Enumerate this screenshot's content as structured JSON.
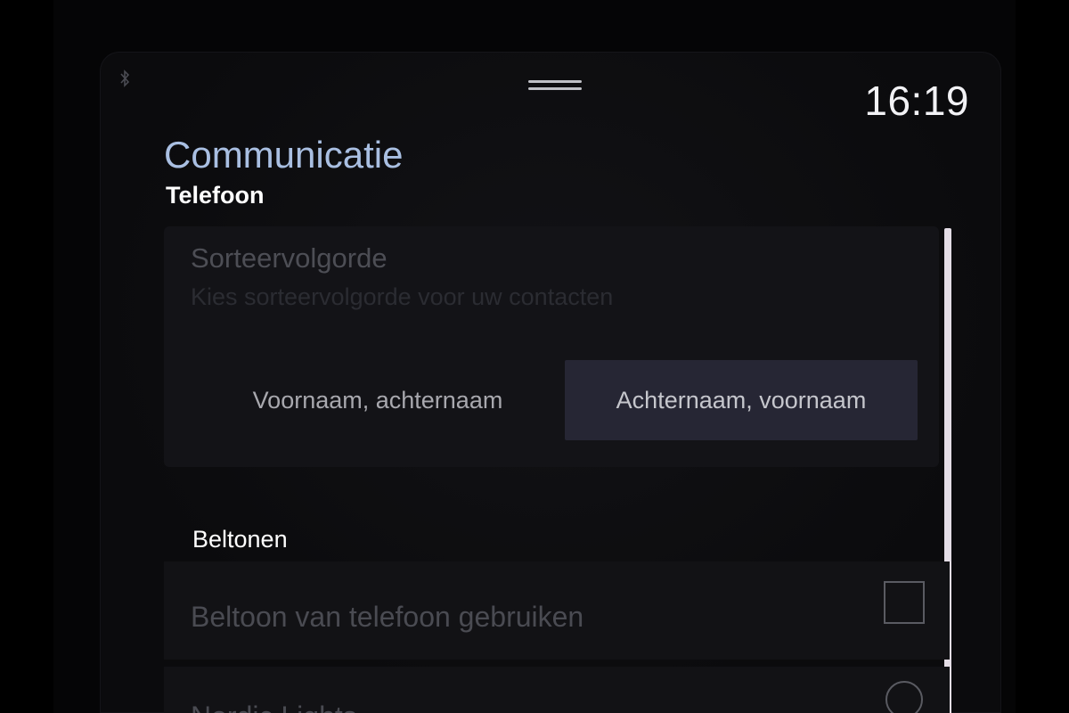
{
  "status_bar": {
    "time": "16:19",
    "bluetooth_icon": "bluetooth-icon"
  },
  "header": {
    "app_title": "Communicatie",
    "section": "Telefoon",
    "handle_icon": "drag-handle-icon"
  },
  "sort_order": {
    "title": "Sorteervolgorde",
    "subtitle": "Kies sorteervolgorde voor uw contacten",
    "options": [
      {
        "label": "Voornaam, achternaam",
        "selected": false
      },
      {
        "label": "Achternaam, voornaam",
        "selected": true
      }
    ]
  },
  "ringtones": {
    "heading": "Beltonen",
    "items": [
      {
        "label": "Beltoon van telefoon gebruiken",
        "control": "checkbox",
        "checked": false
      },
      {
        "label": "Nordic Lights",
        "control": "radio",
        "checked": false
      }
    ]
  },
  "colors": {
    "accent_title": "#a9bfe2",
    "selected_segment": "#262634",
    "scrollbar": "#e4dde6",
    "background": "#0b0b0d"
  }
}
